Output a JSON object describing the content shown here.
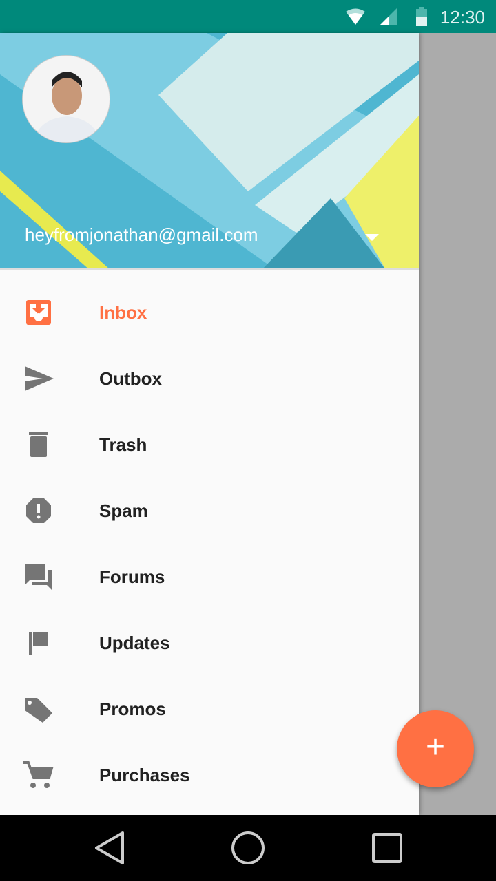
{
  "status_bar": {
    "time": "12:30",
    "icons": [
      "wifi-icon",
      "signal-icon",
      "battery-icon"
    ]
  },
  "header": {
    "email": "heyfromjonathan@gmail.com"
  },
  "menu": [
    {
      "label": "Inbox",
      "icon": "inbox-icon",
      "active": true
    },
    {
      "label": "Outbox",
      "icon": "send-icon"
    },
    {
      "label": "Trash",
      "icon": "trash-icon"
    },
    {
      "label": "Spam",
      "icon": "report-icon"
    },
    {
      "label": "Forums",
      "icon": "forum-icon"
    },
    {
      "label": "Updates",
      "icon": "flag-icon"
    },
    {
      "label": "Promos",
      "icon": "tag-icon"
    },
    {
      "label": "Purchases",
      "icon": "cart-icon"
    }
  ],
  "fab": {
    "label": "+"
  },
  "colors": {
    "accent": "#ff7043",
    "primary": "#00897b",
    "icon": "#757575"
  }
}
